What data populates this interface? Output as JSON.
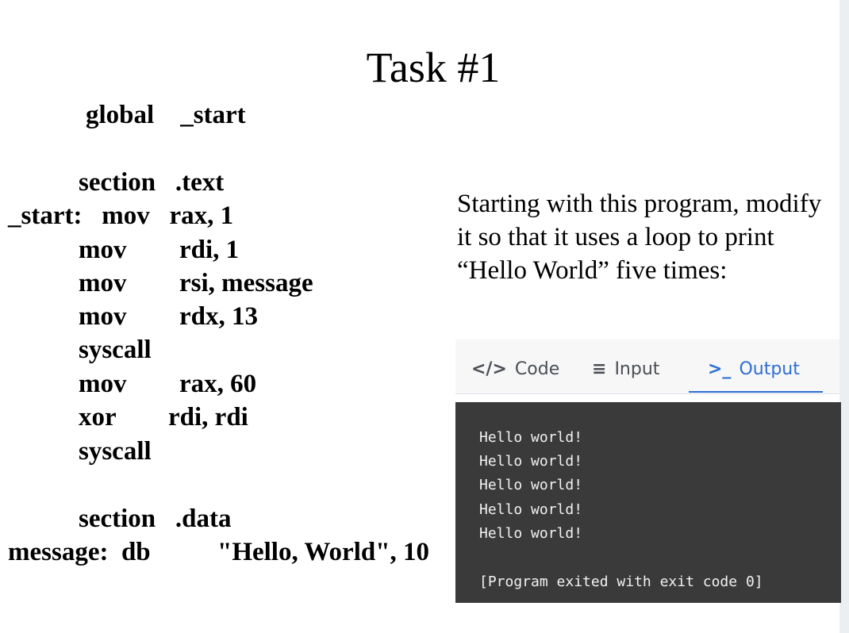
{
  "title": "Task #1",
  "code": {
    "lines": [
      "global    _start",
      "section   .text",
      "_start:   mov   rax, 1",
      "mov",
      "rdi, 1",
      "mov",
      "rsi, message",
      "mov",
      "rdx, 13",
      "syscall",
      "mov",
      "rax, 60",
      "xor",
      "rdi, rdi",
      "syscall",
      "section   .data",
      "message:  db",
      "\"Hello, World\", 10"
    ]
  },
  "prompt": "Starting with this program, modify it so that it uses a loop to print “Hello World” five times:",
  "tabs": [
    {
      "label": "Code",
      "icon": "code-icon"
    },
    {
      "label": "Input",
      "icon": "input-icon"
    },
    {
      "label": "Output",
      "icon": "terminal-icon"
    }
  ],
  "active_tab": "Output",
  "colors": {
    "accent": "#2d6fd3",
    "terminal_bg": "#3a3a3a"
  },
  "output": {
    "lines": [
      "Hello world!",
      "Hello world!",
      "Hello world!",
      "Hello world!",
      "Hello world!"
    ],
    "exit_message": "[Program exited with exit code 0]"
  }
}
